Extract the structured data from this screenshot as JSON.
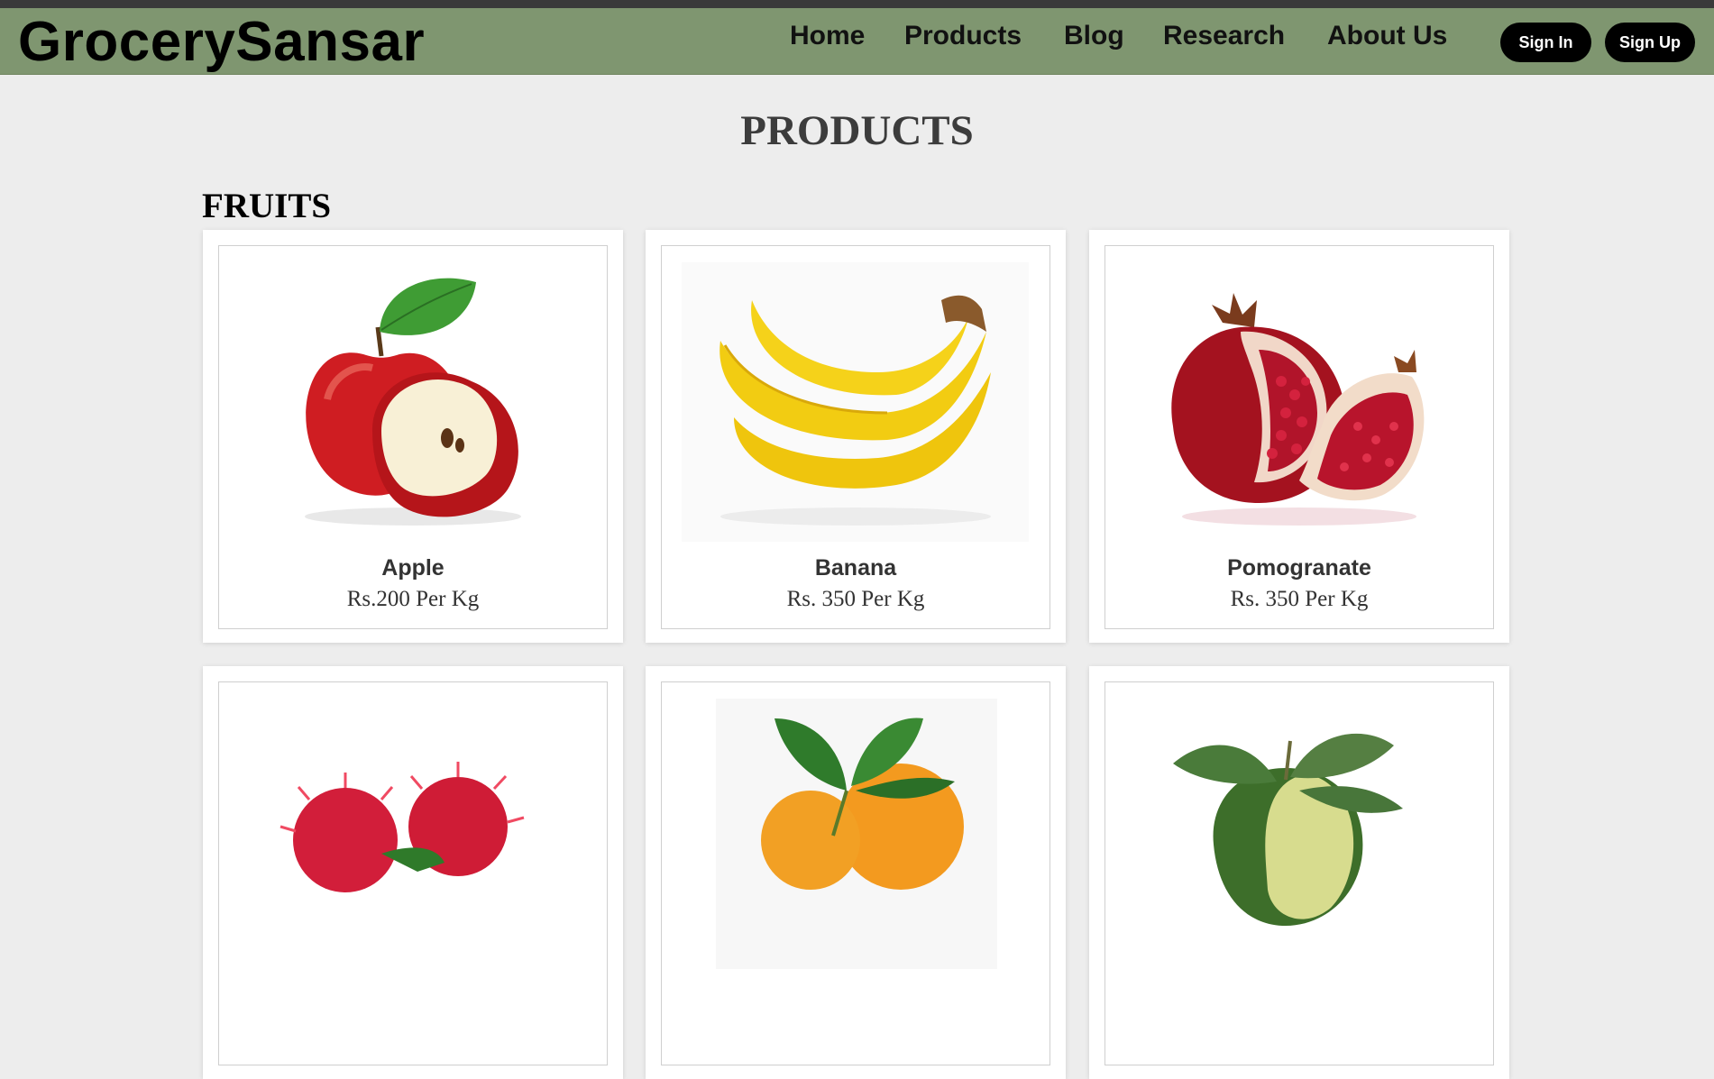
{
  "brand": "GrocerySansar",
  "nav": [
    "Home",
    "Products",
    "Blog",
    "Research",
    "About Us"
  ],
  "auth": {
    "sign_in": "Sign In",
    "sign_up": "Sign Up"
  },
  "page_title": "PRODUCTS",
  "section_title": "FRUITS",
  "products": [
    {
      "name": "Apple",
      "price": "Rs.200 Per Kg",
      "image": "apple-image"
    },
    {
      "name": "Banana",
      "price": "Rs. 350 Per Kg",
      "image": "banana-image"
    },
    {
      "name": "Pomogranate",
      "price": "Rs. 350 Per Kg",
      "image": "pomegranate-image"
    },
    {
      "name": "",
      "price": "",
      "image": "rambutan-image"
    },
    {
      "name": "",
      "price": "",
      "image": "orange-image"
    },
    {
      "name": "",
      "price": "",
      "image": "avocado-image"
    }
  ],
  "colors": {
    "navbar": "#7f9670",
    "background": "#ededed",
    "button": "#000000"
  }
}
